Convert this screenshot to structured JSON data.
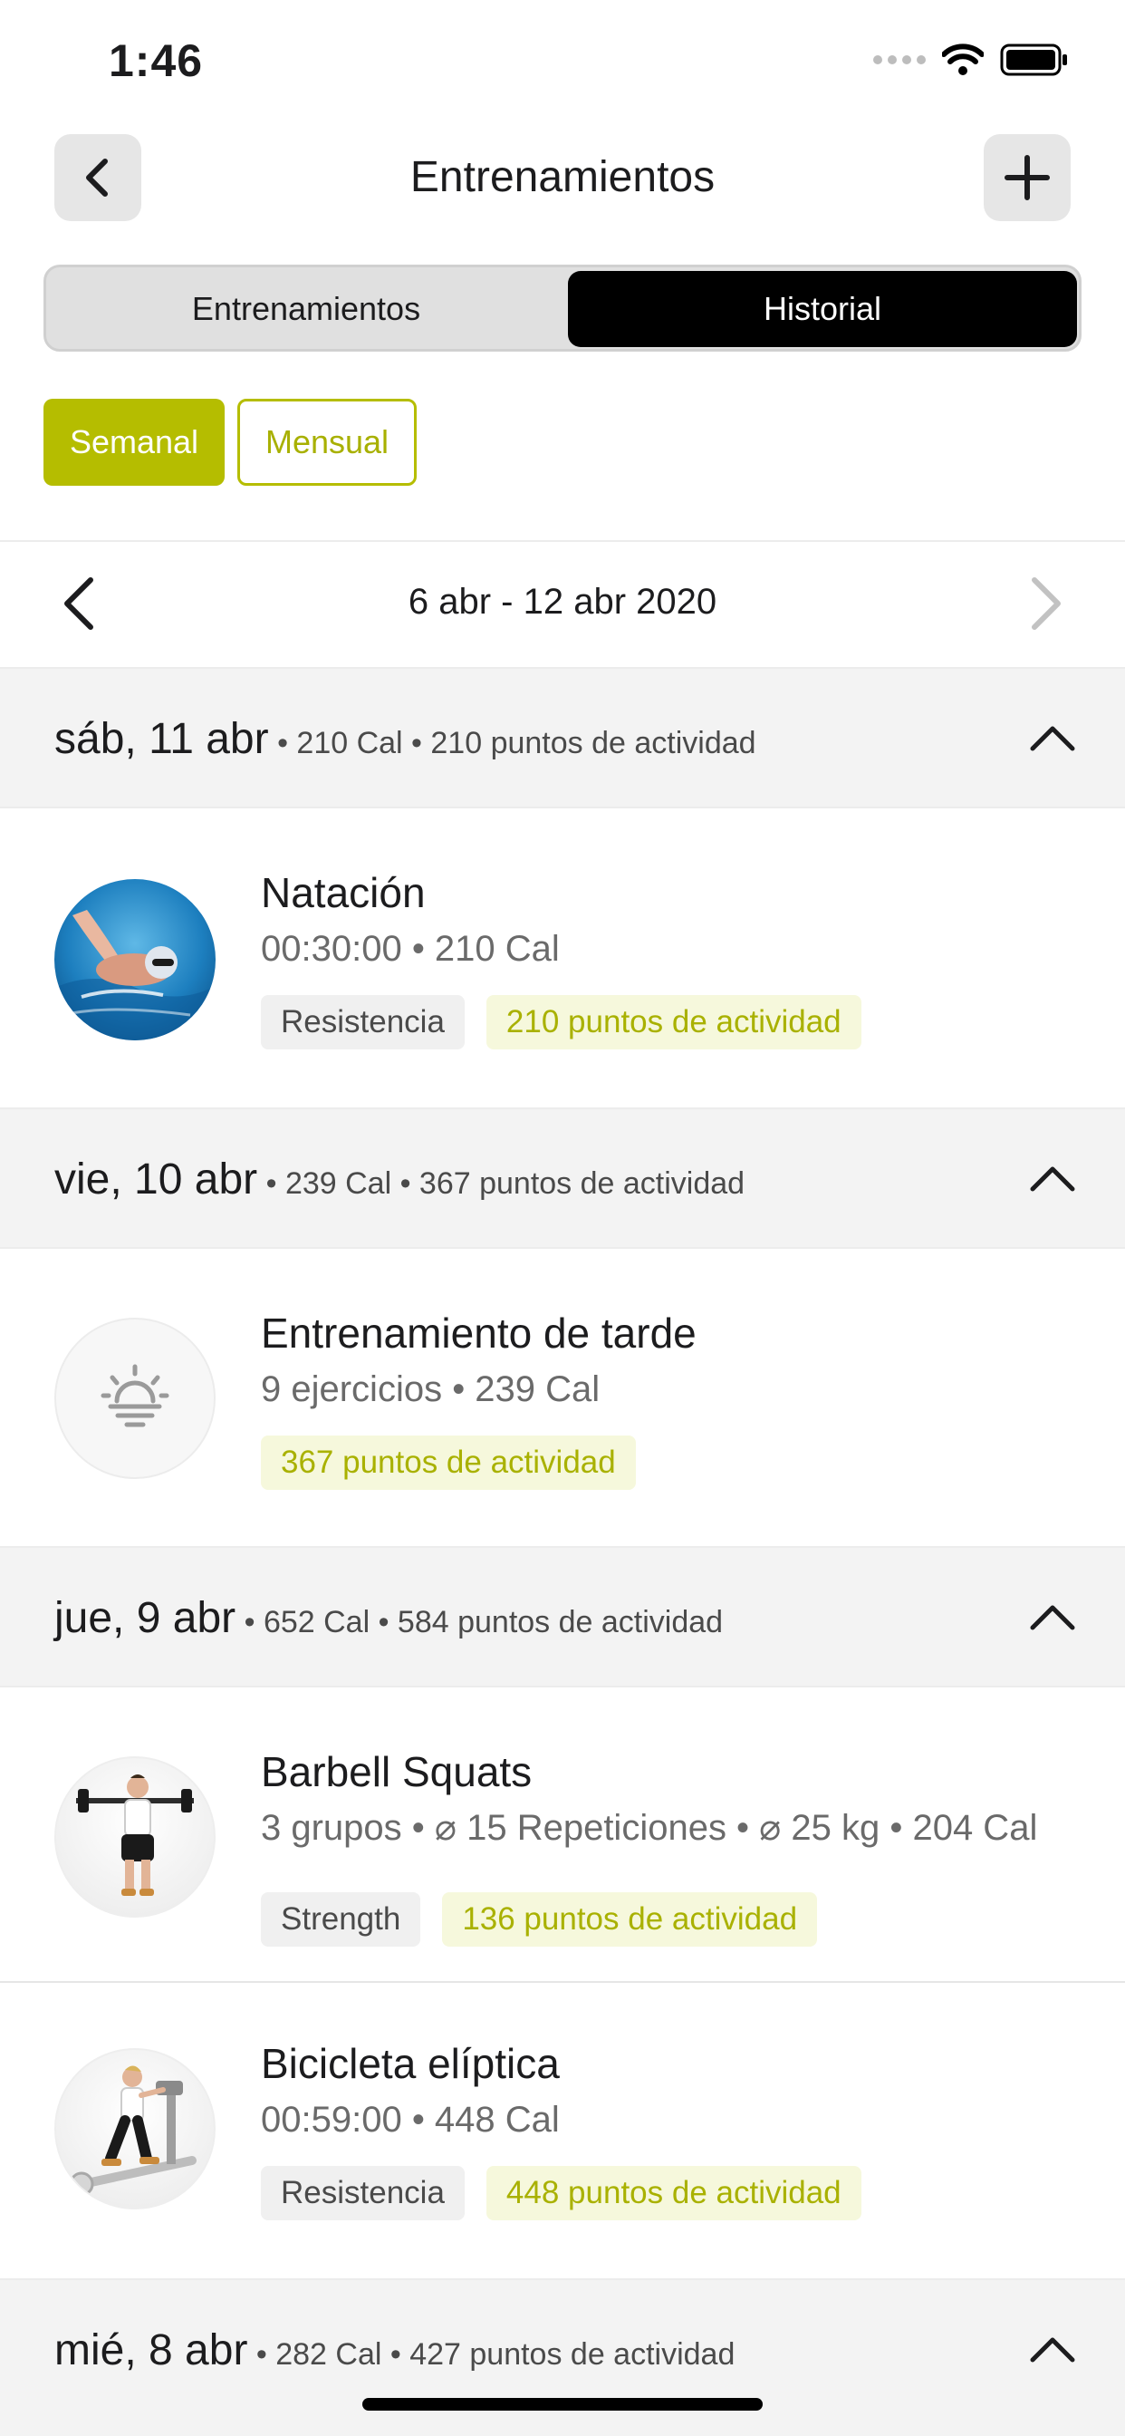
{
  "status_bar": {
    "time": "1:46",
    "icons": [
      "signal-icon",
      "wifi-icon",
      "battery-icon"
    ]
  },
  "nav": {
    "title": "Entrenamientos",
    "back_icon": "chevron-left-icon",
    "add_icon": "plus-icon"
  },
  "segments": {
    "left": "Entrenamientos",
    "right": "Historial",
    "selected": "Historial"
  },
  "filters": {
    "weekly": "Semanal",
    "monthly": "Mensual",
    "selected": "Semanal"
  },
  "week": {
    "label": "6 abr - 12 abr 2020"
  },
  "colors": {
    "accent": "#b5bd00",
    "tag_green_bg": "#f6f8dc",
    "selected_segment": "#000000"
  },
  "days": [
    {
      "date": "sáb, 11 abr",
      "summary": "• 210 Cal • 210 puntos de actividad",
      "entries": [
        {
          "title": "Natación",
          "meta": "00:30:00 • 210 Cal",
          "tag": "Resistencia",
          "points": "210 puntos de actividad",
          "avatar": "swimmer-image"
        }
      ]
    },
    {
      "date": "vie, 10 abr",
      "summary": "• 239 Cal • 367 puntos de actividad",
      "entries": [
        {
          "title": "Entrenamiento de tarde",
          "meta": "9 ejercicios • 239 Cal",
          "points": "367 puntos de actividad",
          "avatar": "sunset-icon"
        }
      ]
    },
    {
      "date": "jue, 9 abr",
      "summary": "• 652 Cal • 584 puntos de actividad",
      "entries": [
        {
          "title": "Barbell Squats",
          "meta": "3 grupos • ⌀ 15 Repeticiones • ⌀ 25 kg • 204 Cal",
          "tag": "Strength",
          "points": "136 puntos de actividad",
          "avatar": "barbell-squat-image"
        },
        {
          "title": "Bicicleta elíptica",
          "meta": "00:59:00 • 448 Cal",
          "tag": "Resistencia",
          "points": "448 puntos de actividad",
          "avatar": "elliptical-image"
        }
      ]
    },
    {
      "date": "mié, 8 abr",
      "summary": "• 282 Cal • 427 puntos de actividad",
      "entries": []
    }
  ]
}
